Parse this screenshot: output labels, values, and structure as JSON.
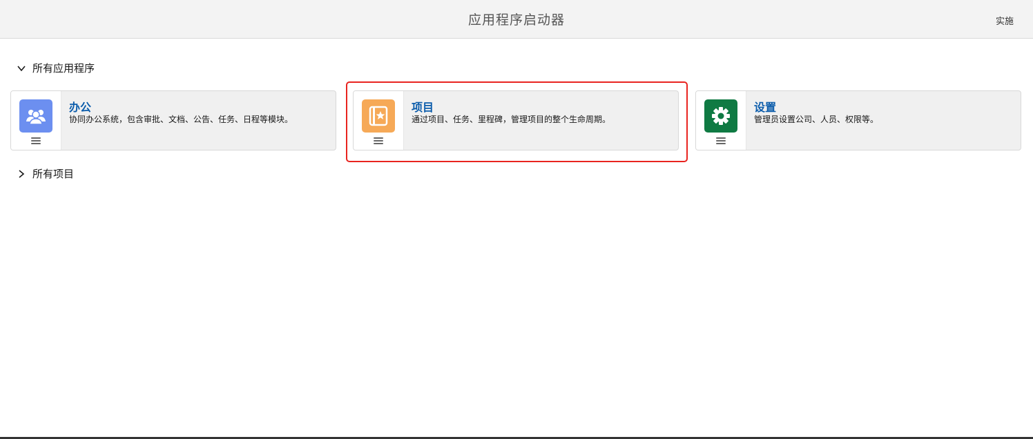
{
  "header": {
    "title": "应用程序启动器",
    "action_label": "实施"
  },
  "sections": [
    {
      "label": "所有应用程序",
      "expanded": true
    },
    {
      "label": "所有项目",
      "expanded": false
    }
  ],
  "apps": [
    {
      "name": "办公",
      "description": "协同办公系统，包含审批、文档、公告、任务、日程等模块。",
      "icon": "people-icon",
      "icon_color": "#6c8ff0"
    },
    {
      "name": "项目",
      "description": "通过项目、任务、里程碑，管理项目的整个生命周期。",
      "icon": "notebook-star-icon",
      "icon_color": "#f6a957"
    },
    {
      "name": "设置",
      "description": "管理员设置公司、人员、权限等。",
      "icon": "gear-icon",
      "icon_color": "#0f7a43"
    }
  ],
  "colors": {
    "highlight": "#e8231f",
    "app_name": "#0b5cab"
  }
}
